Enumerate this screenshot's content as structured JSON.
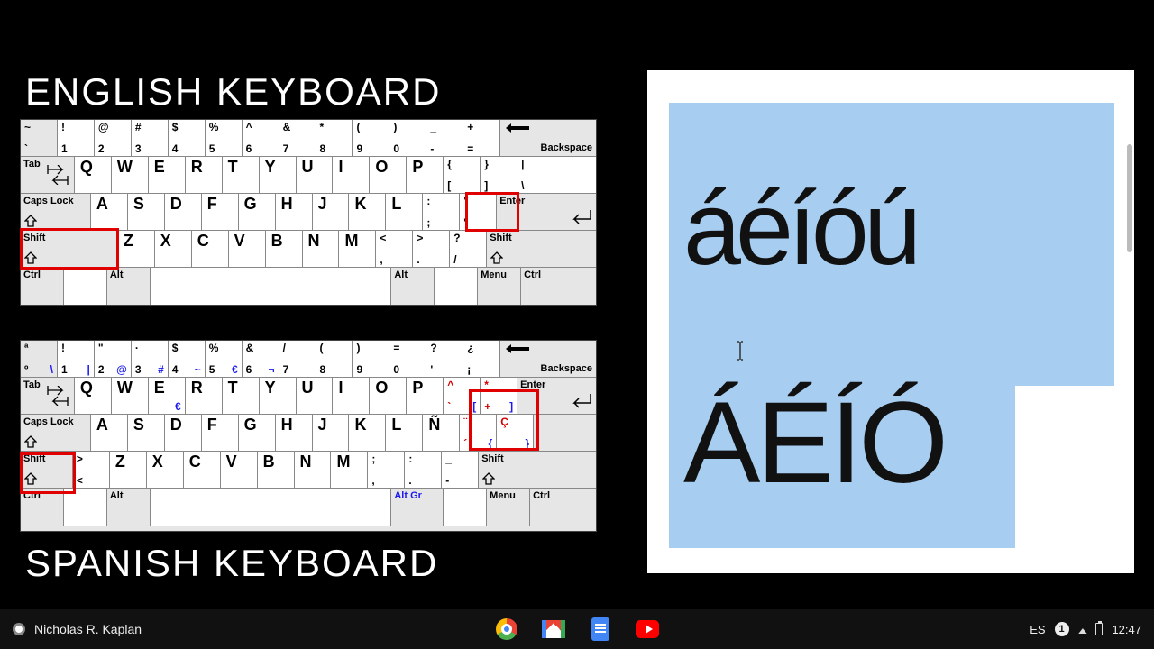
{
  "titles": {
    "english": "ENGLISH KEYBOARD",
    "spanish": "SPANISH KEYBOARD"
  },
  "output": {
    "line1": "áéíóú",
    "line2": "ÁÉÍÓ"
  },
  "shelf": {
    "user": "Nicholas R. Kaplan",
    "ime": "ES",
    "notif_count": "1",
    "time": "12:47"
  },
  "kbd_labels": {
    "backspace": "Backspace",
    "tab": "Tab",
    "caps": "Caps Lock",
    "shift": "Shift",
    "ctrl": "Ctrl",
    "alt": "Alt",
    "altgr": "Alt Gr",
    "menu": "Menu",
    "enter": "Enter"
  },
  "en_rows": {
    "num": [
      {
        "t": "~",
        "b": "`"
      },
      {
        "t": "!",
        "b": "1"
      },
      {
        "t": "@",
        "b": "2"
      },
      {
        "t": "#",
        "b": "3"
      },
      {
        "t": "$",
        "b": "4"
      },
      {
        "t": "%",
        "b": "5"
      },
      {
        "t": "^",
        "b": "6"
      },
      {
        "t": "&",
        "b": "7"
      },
      {
        "t": "*",
        "b": "8"
      },
      {
        "t": "(",
        "b": "9"
      },
      {
        "t": ")",
        "b": "0"
      },
      {
        "t": "_",
        "b": "-"
      },
      {
        "t": "+",
        "b": "="
      }
    ],
    "q": [
      "Q",
      "W",
      "E",
      "R",
      "T",
      "Y",
      "U",
      "I",
      "O",
      "P"
    ],
    "q_tail": [
      {
        "t": "{",
        "b": "["
      },
      {
        "t": "}",
        "b": "]"
      },
      {
        "t": "|",
        "b": "\\"
      }
    ],
    "a": [
      "A",
      "S",
      "D",
      "F",
      "G",
      "H",
      "J",
      "K",
      "L"
    ],
    "a_tail": [
      {
        "t": ":",
        "b": ";"
      },
      {
        "t": "\"",
        "b": "'"
      }
    ],
    "z": [
      "Z",
      "X",
      "C",
      "V",
      "B",
      "N",
      "M"
    ],
    "z_tail": [
      {
        "t": "<",
        "b": ","
      },
      {
        "t": ">",
        "b": "."
      },
      {
        "t": "?",
        "b": "/"
      }
    ]
  },
  "es_rows": {
    "num": [
      {
        "t": "ª",
        "b": "º",
        "r": "\\"
      },
      {
        "t": "!",
        "b": "1",
        "r": "|"
      },
      {
        "t": "\"",
        "b": "2",
        "r": "@"
      },
      {
        "t": "·",
        "b": "3",
        "r": "#"
      },
      {
        "t": "$",
        "b": "4",
        "r": "~"
      },
      {
        "t": "%",
        "b": "5",
        "r": "€"
      },
      {
        "t": "&",
        "b": "6",
        "r": "¬"
      },
      {
        "t": "/",
        "b": "7"
      },
      {
        "t": "(",
        "b": "8"
      },
      {
        "t": ")",
        "b": "9"
      },
      {
        "t": "=",
        "b": "0"
      },
      {
        "t": "?",
        "b": "'"
      },
      {
        "t": "¿",
        "b": "¡"
      }
    ],
    "q": [
      "Q",
      "W",
      "E",
      "R",
      "T",
      "Y",
      "U",
      "I",
      "O",
      "P"
    ],
    "q_euro_idx": 2,
    "q_tail": [
      {
        "t": "^",
        "b": "`",
        "r": "["
      },
      {
        "t": "*",
        "b": "+",
        "r": "]"
      }
    ],
    "a": [
      "A",
      "S",
      "D",
      "F",
      "G",
      "H",
      "J",
      "K",
      "L",
      "Ñ"
    ],
    "a_tail": [
      {
        "t": "¨",
        "b": "´",
        "r": "{"
      },
      {
        "t": "Ç",
        "b": "",
        "r": "}"
      }
    ],
    "z_lead": {
      "t": ">",
      "b": "<"
    },
    "z": [
      "Z",
      "X",
      "C",
      "V",
      "B",
      "N",
      "M"
    ],
    "z_tail": [
      {
        "t": ";",
        "b": ","
      },
      {
        "t": ":",
        "b": "."
      },
      {
        "t": "_",
        "b": "-"
      }
    ]
  }
}
